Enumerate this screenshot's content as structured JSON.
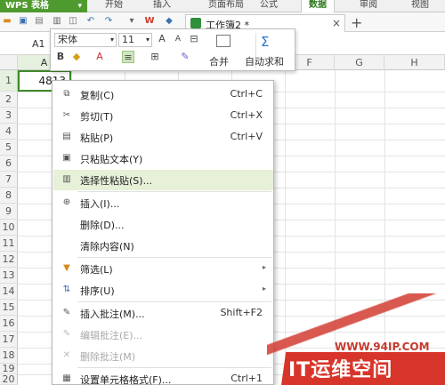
{
  "app": {
    "brand": "WPS 表格",
    "tabs": [
      "开始",
      "插入",
      "页面布局",
      "公式",
      "数据",
      "审阅",
      "视图"
    ],
    "active_tab": "数据"
  },
  "document": {
    "tab_title": "工作簿2 *"
  },
  "name_box": "A1",
  "mini_toolbar": {
    "font": "宋体",
    "size": "11",
    "merge_label": "合并",
    "autosum_label": "自动求和"
  },
  "grid": {
    "columns": [
      "A",
      "B",
      "C",
      "D",
      "E",
      "F",
      "G",
      "H"
    ],
    "rows": [
      "1",
      "2",
      "3",
      "4",
      "5",
      "6",
      "7",
      "8",
      "9",
      "10",
      "11",
      "12",
      "13",
      "14",
      "15",
      "16",
      "17",
      "18",
      "19",
      "20"
    ],
    "cell_a1": "4813"
  },
  "context_menu": {
    "items": [
      {
        "icon": "copy-icon",
        "label": "复制(C)",
        "shortcut": "Ctrl+C"
      },
      {
        "icon": "cut-icon",
        "label": "剪切(T)",
        "shortcut": "Ctrl+X"
      },
      {
        "icon": "paste-icon",
        "label": "粘贴(P)",
        "shortcut": "Ctrl+V"
      },
      {
        "icon": "paste-text-icon",
        "label": "只粘贴文本(Y)",
        "shortcut": ""
      },
      {
        "icon": "paste-special-icon",
        "label": "选择性粘贴(S)...",
        "shortcut": ""
      },
      {
        "icon": "insert-icon",
        "label": "插入(I)...",
        "shortcut": ""
      },
      {
        "icon": "",
        "label": "删除(D)...",
        "shortcut": ""
      },
      {
        "icon": "",
        "label": "清除内容(N)",
        "shortcut": ""
      },
      {
        "icon": "filter-icon",
        "label": "筛选(L)",
        "shortcut": ""
      },
      {
        "icon": "sort-icon",
        "label": "排序(U)",
        "shortcut": ""
      },
      {
        "icon": "comment-icon",
        "label": "插入批注(M)...",
        "shortcut": "Shift+F2"
      },
      {
        "icon": "edit-comment-icon",
        "label": "编辑批注(E)...",
        "shortcut": ""
      },
      {
        "icon": "delete-comment-icon",
        "label": "删除批注(M)",
        "shortcut": ""
      },
      {
        "icon": "format-cells-icon",
        "label": "设置单元格格式(F)...",
        "shortcut": "Ctrl+1"
      }
    ]
  },
  "watermark": {
    "url": "WWW.94IP.COM",
    "text": "IT运维空间"
  }
}
